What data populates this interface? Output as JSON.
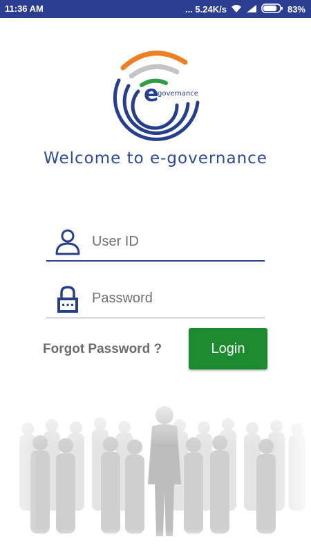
{
  "status_bar": {
    "time": "11:36 AM",
    "network_speed": "... 5.24K/s",
    "battery_percent": "83%",
    "battery_level": 0.83,
    "icons": [
      "wifi-icon",
      "signal-icon",
      "battery-icon"
    ]
  },
  "branding": {
    "logo_letter": "e",
    "logo_text": "governance",
    "welcome_text": "Welcome to e-governance",
    "colors": {
      "brand_blue": "#2c4a96",
      "saffron": "#f07f22",
      "green": "#2e9e44",
      "grey": "#c4c4c4"
    }
  },
  "form": {
    "user_id": {
      "placeholder": "User ID",
      "value": ""
    },
    "password": {
      "placeholder": "Password",
      "value": ""
    },
    "forgot_label": "Forgot Password ?",
    "login_label": "Login",
    "accent": "#1d8a2f"
  }
}
